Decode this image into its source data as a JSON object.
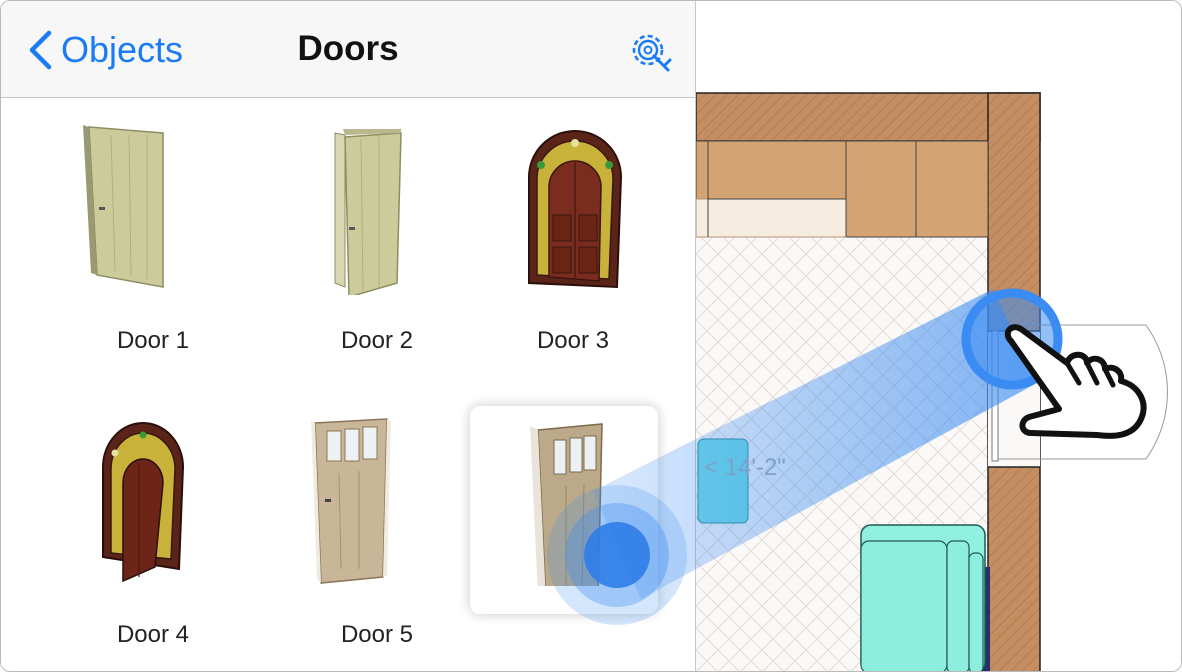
{
  "navbar": {
    "back_label": "Objects",
    "title": "Doors"
  },
  "doors": [
    {
      "label": "Door 1"
    },
    {
      "label": "Door 2"
    },
    {
      "label": "Door 3"
    },
    {
      "label": "Door 4"
    },
    {
      "label": "Door 5"
    },
    {
      "label": "",
      "selected": true
    }
  ],
  "plan": {
    "dimension_label": "< 14'-2\""
  },
  "colors": {
    "accent": "#1a7cf5",
    "wall": "#c58e62",
    "cabinet": "#d4a373",
    "furniture": "#92f0df"
  }
}
